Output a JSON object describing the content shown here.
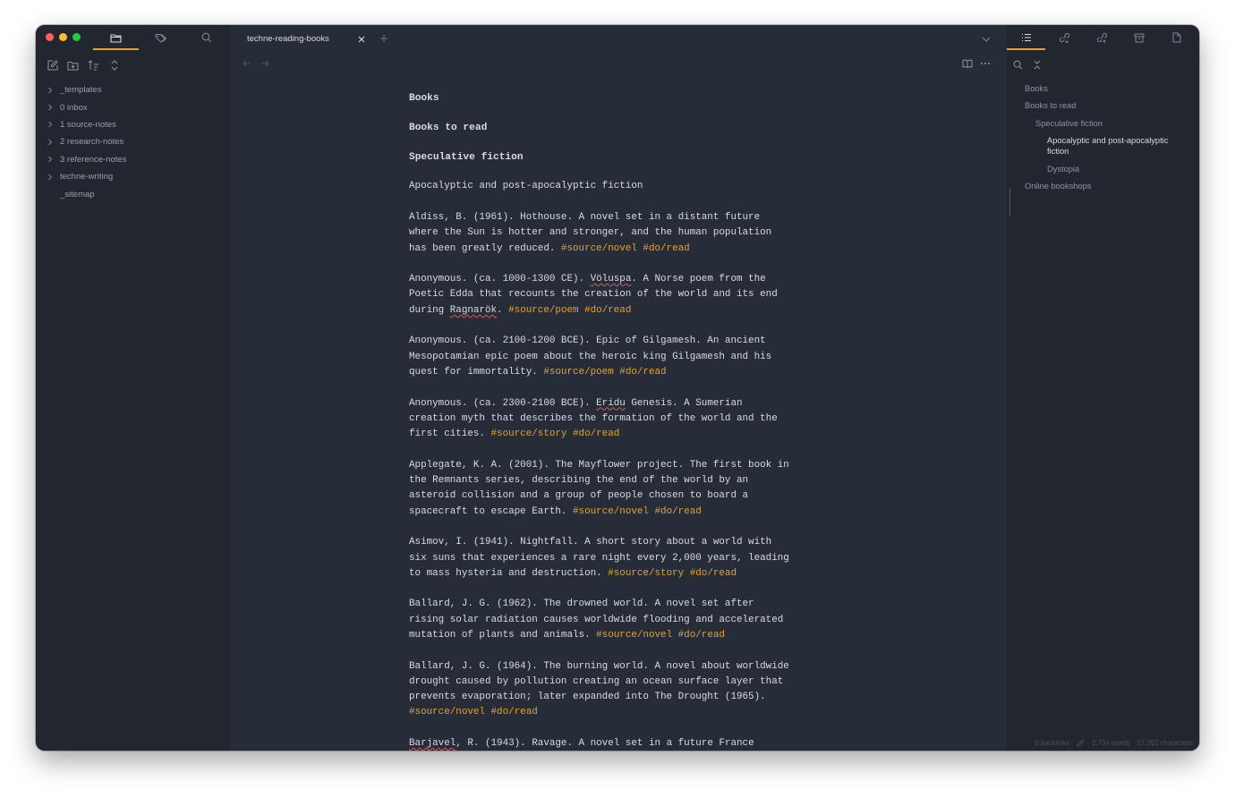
{
  "left_sidebar": {
    "tabs": [
      {
        "icon": "folder-icon",
        "active": true
      },
      {
        "icon": "tags-icon",
        "active": false
      },
      {
        "icon": "search-icon",
        "active": false
      }
    ],
    "tools": [
      "new-note-icon",
      "new-folder-icon",
      "sort-icon",
      "expand-collapse-icon"
    ],
    "tree": [
      {
        "label": "_templates",
        "folder": true
      },
      {
        "label": "0 inbox",
        "folder": true
      },
      {
        "label": "1 source-notes",
        "folder": true
      },
      {
        "label": "2 research-notes",
        "folder": true
      },
      {
        "label": "3 reference-notes",
        "folder": true
      },
      {
        "label": "techne-writing",
        "folder": true
      },
      {
        "label": "_sitemap",
        "folder": false
      }
    ]
  },
  "main": {
    "tab_title": "techne-reading-books",
    "headings": {
      "h1": "Books",
      "h2": "Books to read",
      "h3": "Speculative fiction",
      "h4": "Apocalyptic and post-apocalyptic fiction"
    },
    "entries": [
      {
        "lines": [
          "Aldiss, B. (1961). Hothouse. A novel set in a distant future",
          "where the Sun is hotter and stronger, and the human population"
        ],
        "last": "has been greatly reduced. ",
        "tags": "#source/novel #do/read"
      },
      {
        "l1a": "Anonymous. (ca. 1000-1300 CE). ",
        "l1sq": "Völuspa",
        "l1b": ". A Norse poem from the",
        "l2": "Poetic Edda that recounts the creation of the world and its end",
        "l3a": "during ",
        "l3sq": "Ragnarök",
        "l3b": ". ",
        "tags": "#source/poem #do/read"
      },
      {
        "lines": [
          "Anonymous. (ca. 2100-1200 BCE). Epic of Gilgamesh. An ancient",
          "Mesopotamian epic poem about the heroic king Gilgamesh and his"
        ],
        "last": "quest for immortality. ",
        "tags": "#source/poem #do/read"
      },
      {
        "l1a": "Anonymous. (ca. 2300-2100 BCE). ",
        "l1sq": "Eridu",
        "l1b": " Genesis. A Sumerian",
        "l2": "creation myth that describes the formation of the world and the",
        "l3a": "first cities. ",
        "tags": "#source/story #do/read"
      },
      {
        "lines": [
          "Applegate, K. A. (2001). The Mayflower project. The first book in",
          "the Remnants series, describing the end of the world by an",
          "asteroid collision and a group of people chosen to board a"
        ],
        "last": "spacecraft to escape Earth. ",
        "tags": "#source/novel #do/read"
      },
      {
        "lines": [
          "Asimov, I. (1941). Nightfall. A short story about a world with",
          "six suns that experiences a rare night every 2,000 years, leading"
        ],
        "last": "to mass hysteria and destruction. ",
        "tags": "#source/story #do/read"
      },
      {
        "lines": [
          "Ballard, J. G. (1962). The drowned world. A novel set after",
          "rising solar radiation causes worldwide flooding and accelerated"
        ],
        "last": "mutation of plants and animals. ",
        "tags": "#source/novel #do/read"
      },
      {
        "lines": [
          "Ballard, J. G. (1964). The burning world. A novel about worldwide",
          "drought caused by pollution creating an ocean surface layer that",
          "prevents evaporation; later expanded into The Drought (1965)."
        ],
        "last": "",
        "tags": "#source/novel #do/read"
      },
      {
        "partial_sq": "Barjavel",
        "partial": ", R. (1943). Ravage. A novel set in a future France"
      }
    ]
  },
  "right_sidebar": {
    "tabs": [
      "outline-icon",
      "backlinks-icon",
      "outgoing-links-icon",
      "archive-icon",
      "file-icon"
    ],
    "outline": [
      {
        "label": "Books",
        "level": 1
      },
      {
        "label": "Books to read",
        "level": 1
      },
      {
        "label": "Speculative fiction",
        "level": 2
      },
      {
        "label": "Apocalyptic and post-apocalyptic fiction",
        "level": 3,
        "active": true
      },
      {
        "label": "Dystopia",
        "level": 3
      },
      {
        "label": "Online bookshops",
        "level": 1
      }
    ]
  },
  "status": {
    "backlinks": "0 backlinks",
    "words": "2,734 words",
    "characters": "17,092 characters"
  },
  "colors": {
    "accent": "#e3a336",
    "background": "#262c38",
    "sidebar": "#21262f",
    "text": "#d8dce3",
    "muted": "#8e95a2"
  }
}
